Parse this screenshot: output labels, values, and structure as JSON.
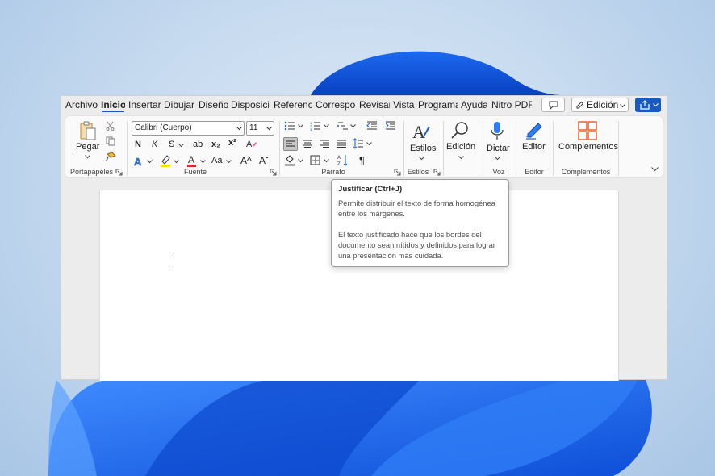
{
  "tabs": [
    {
      "label": "Archivo",
      "active": false
    },
    {
      "label": "Inicio",
      "active": true
    },
    {
      "label": "Insertar",
      "active": false
    },
    {
      "label": "Dibujar",
      "active": false
    },
    {
      "label": "Diseño",
      "active": false
    },
    {
      "label": "Disposición",
      "active": false
    },
    {
      "label": "Referencias",
      "active": false
    },
    {
      "label": "Correspondencia",
      "active": false
    },
    {
      "label": "Revisar",
      "active": false
    },
    {
      "label": "Vista",
      "active": false
    },
    {
      "label": "Programador",
      "active": false
    },
    {
      "label": "Ayuda",
      "active": false
    },
    {
      "label": "Nitro PDF",
      "active": false
    }
  ],
  "header": {
    "edit_mode_label": "Edición",
    "comment_icon": "comment-icon",
    "share_icon": "share-icon"
  },
  "ribbon": {
    "clipboard": {
      "paste_label": "Pegar",
      "group_label": "Portapapeles"
    },
    "font": {
      "font_name": "Calibri (Cuerpo)",
      "font_size": "11",
      "bold_label": "N",
      "italic_label": "K",
      "underline_label": "S",
      "strike_label": "ab",
      "subscript_label": "x₂",
      "superscript_label": "x²",
      "change_case_label": "Aa",
      "grow_label": "A^",
      "shrink_label": "Aˇ",
      "group_label": "Fuente"
    },
    "paragraph": {
      "group_label": "Párrafo",
      "pilcrow": "¶"
    },
    "styles": {
      "label": "Estilos",
      "group_label": "Estilos"
    },
    "editing": {
      "label": "Edición"
    },
    "voice": {
      "label": "Dictar",
      "group_label": "Voz"
    },
    "editor": {
      "label": "Editor",
      "group_label": "Editor"
    },
    "addins": {
      "label": "Complementos",
      "group_label": "Complementos"
    }
  },
  "tooltip": {
    "title": "Justificar (Ctrl+J)",
    "paragraph1": "Permite distribuir el texto de forma homogénea entre los márgenes.",
    "paragraph2": "El texto justificado hace que los bordes del documento sean nítidos y definidos para lograr una presentación más cuidada."
  },
  "colors": {
    "accent": "#185abd",
    "highlight_yellow": "#ffe100",
    "font_red": "#d62b2b"
  }
}
